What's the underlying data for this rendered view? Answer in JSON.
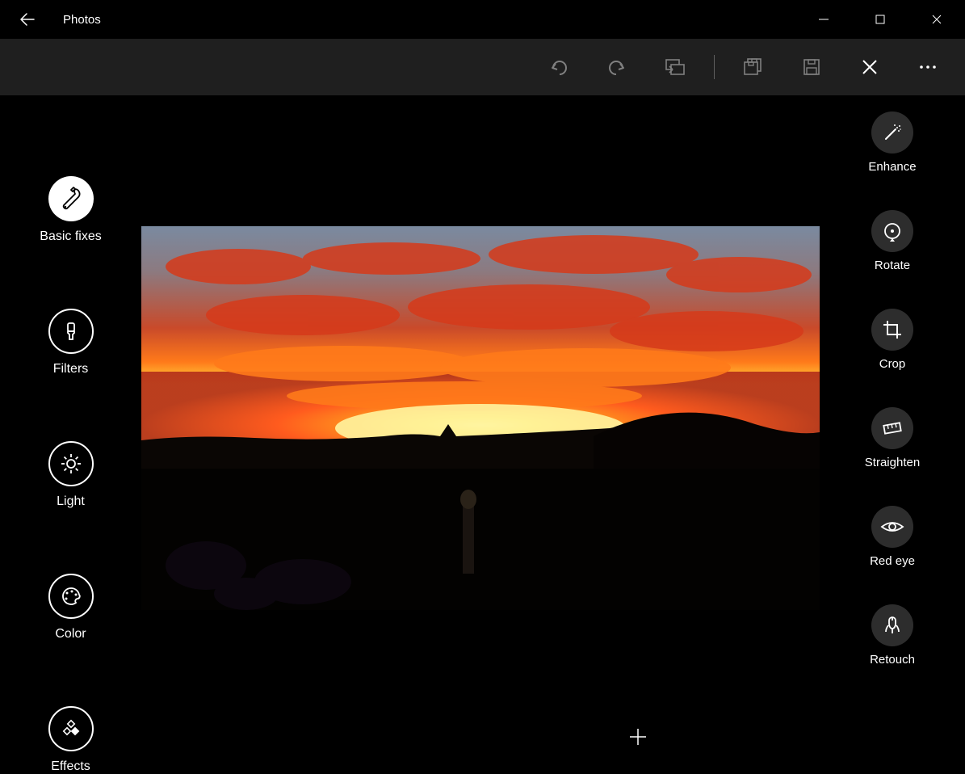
{
  "app_title": "Photos",
  "left_tools": {
    "basic_fixes": "Basic fixes",
    "filters": "Filters",
    "light": "Light",
    "color": "Color",
    "effects": "Effects"
  },
  "right_tools": {
    "enhance": "Enhance",
    "rotate": "Rotate",
    "crop": "Crop",
    "straighten": "Straighten",
    "red_eye": "Red eye",
    "retouch": "Retouch"
  }
}
